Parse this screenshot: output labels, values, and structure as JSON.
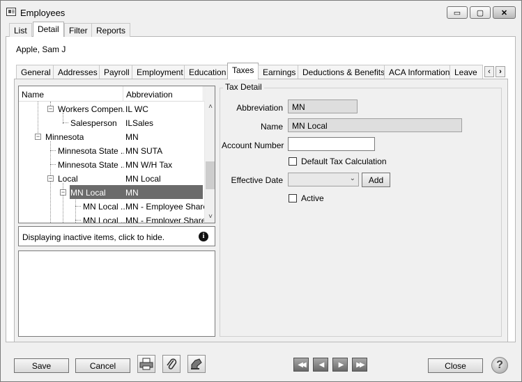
{
  "window": {
    "title": "Employees",
    "minimize_glyph": "▭",
    "maximize_glyph": "▢",
    "close_glyph": "✕"
  },
  "top_tabs": [
    {
      "label": "List",
      "active": false
    },
    {
      "label": "Detail",
      "active": true
    },
    {
      "label": "Filter",
      "active": false
    },
    {
      "label": "Reports",
      "active": false
    }
  ],
  "employee_name": "Apple, Sam J",
  "sub_tabs": [
    {
      "label": "General"
    },
    {
      "label": "Addresses"
    },
    {
      "label": "Payroll"
    },
    {
      "label": "Employment"
    },
    {
      "label": "Education"
    },
    {
      "label": "Taxes",
      "active": true
    },
    {
      "label": "Earnings"
    },
    {
      "label": "Deductions & Benefits"
    },
    {
      "label": "ACA Information"
    },
    {
      "label": "Leave"
    }
  ],
  "tab_scroll": {
    "left": "‹",
    "right": "›"
  },
  "tree": {
    "col_name": "Name",
    "col_abbr": "Abbreviation",
    "scroll_up": "˄",
    "scroll_down": "˅",
    "rows": [
      {
        "name": "Workers Compen...",
        "abbr": "IL WC"
      },
      {
        "name": "Salesperson",
        "abbr": "ILSales"
      },
      {
        "name": "Minnesota",
        "abbr": "MN"
      },
      {
        "name": "Minnesota State ...",
        "abbr": "MN SUTA"
      },
      {
        "name": "Minnesota State ...",
        "abbr": "MN W/H Tax"
      },
      {
        "name": "Local",
        "abbr": "MN Local"
      },
      {
        "name": "MN Local",
        "abbr": "MN",
        "selected": true
      },
      {
        "name": "MN Local ...",
        "abbr": "MN - Employee Share"
      },
      {
        "name": "MN Local ...",
        "abbr": "MN - Employer Share"
      }
    ]
  },
  "info_bar": {
    "text": "Displaying inactive items, click to hide.",
    "icon": "i"
  },
  "tax_detail": {
    "group_title": "Tax Detail",
    "abbreviation_label": "Abbreviation",
    "abbreviation_value": "MN",
    "name_label": "Name",
    "name_value": "MN Local",
    "account_number_label": "Account Number",
    "account_number_value": "",
    "default_tax_calc_label": "Default Tax Calculation",
    "default_tax_calc_checked": false,
    "effective_date_label": "Effective Date",
    "effective_date_value": "",
    "add_label": "Add",
    "active_label": "Active",
    "active_checked": false
  },
  "footer": {
    "save_label": "Save",
    "cancel_label": "Cancel",
    "close_label": "Close",
    "nav_first": "◀◀",
    "nav_prev": "◀",
    "nav_next": "▶",
    "nav_last": "▶▶",
    "help_glyph": "?"
  }
}
